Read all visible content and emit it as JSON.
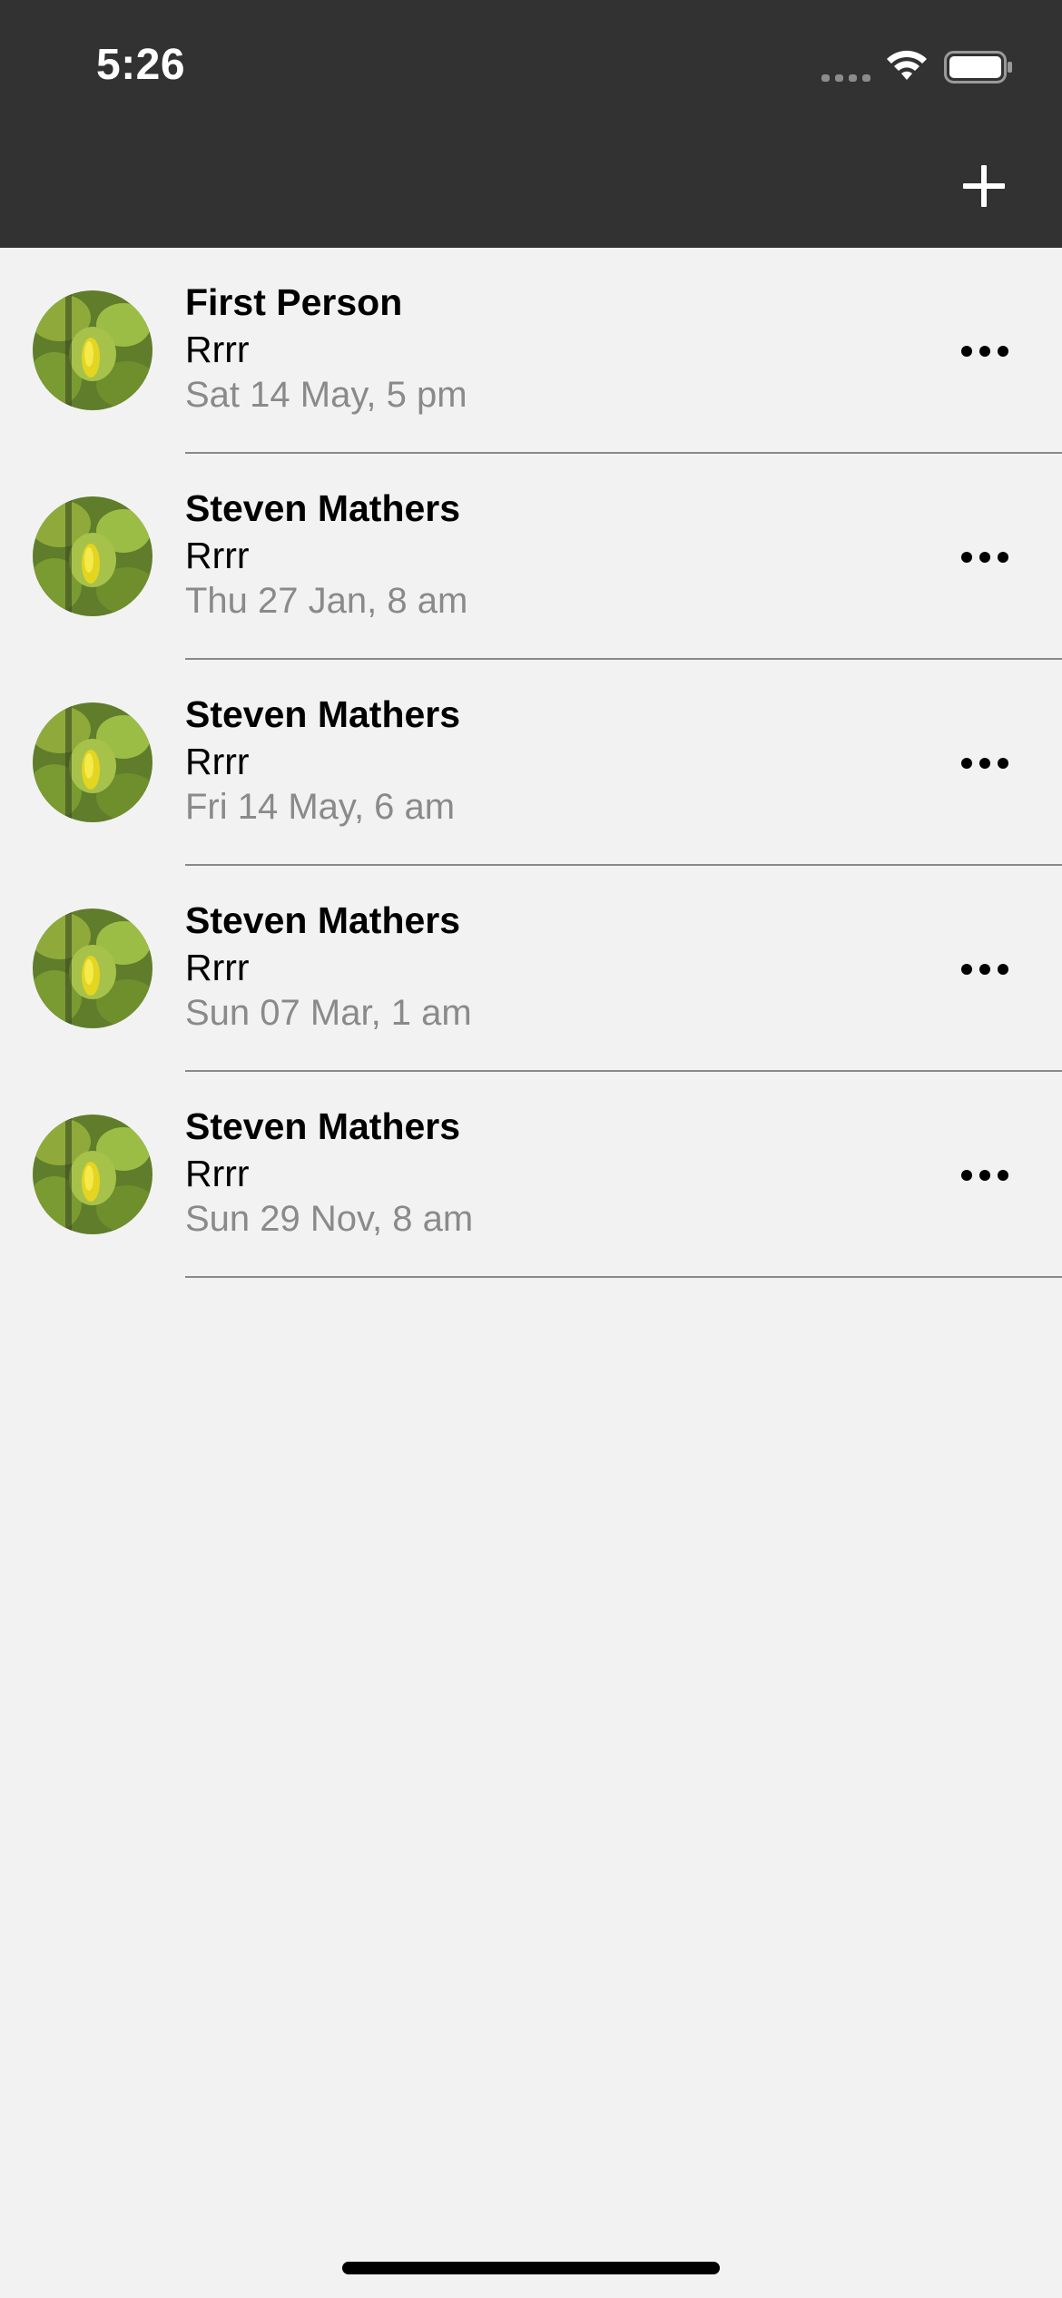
{
  "status_bar": {
    "time": "5:26"
  },
  "header": {
    "add_icon": "plus-icon"
  },
  "conversations": [
    {
      "name": "First Person",
      "message": "Rrrr",
      "time": "Sat 14 May, 5 pm"
    },
    {
      "name": "Steven Mathers",
      "message": "Rrrr",
      "time": "Thu 27 Jan, 8 am"
    },
    {
      "name": "Steven Mathers",
      "message": "Rrrr",
      "time": "Fri 14 May, 6 am"
    },
    {
      "name": "Steven Mathers",
      "message": "Rrrr",
      "time": "Sun 07 Mar, 1 am"
    },
    {
      "name": "Steven Mathers",
      "message": "Rrrr",
      "time": "Sun 29 Nov, 8 am"
    }
  ],
  "colors": {
    "header_background": "#323232",
    "list_background": "#f2f2f2",
    "secondary_text": "#8a8a8a"
  }
}
